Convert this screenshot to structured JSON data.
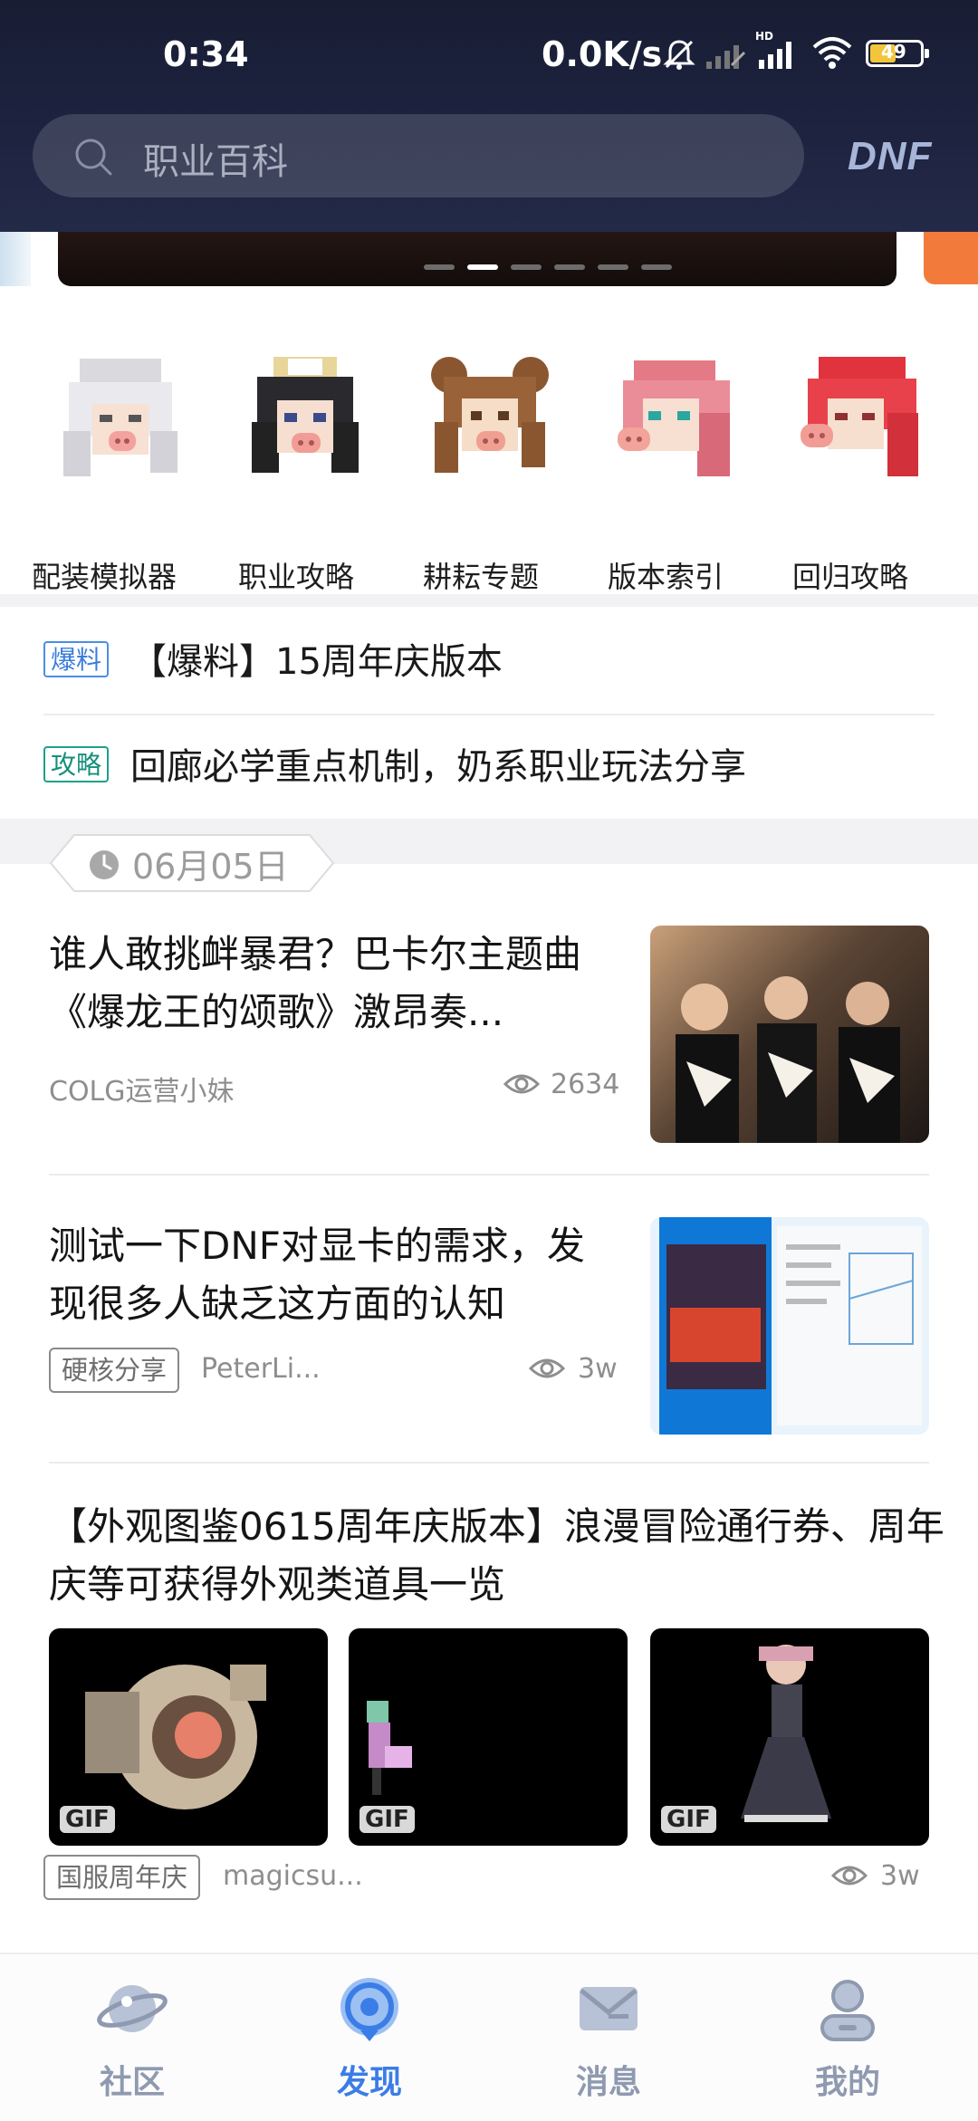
{
  "status_bar": {
    "time": "0:34",
    "network_speed": "0.0K/s",
    "battery": "49"
  },
  "search": {
    "placeholder": "职业百科",
    "brand": "DNF"
  },
  "banner": {
    "page_count": 6,
    "active_index": 1
  },
  "shortcuts": [
    {
      "label": "配装模拟器",
      "icon": "character-white-hair-icon"
    },
    {
      "label": "职业攻略",
      "icon": "character-black-hair-icon"
    },
    {
      "label": "耕耘专题",
      "icon": "character-brown-buns-icon"
    },
    {
      "label": "版本索引",
      "icon": "character-pink-hair-icon"
    },
    {
      "label": "回归攻略",
      "icon": "character-red-hair-icon"
    }
  ],
  "ticker": [
    {
      "tag": "爆料",
      "text": "【爆料】15周年庆版本",
      "tag_color": "#3b7ddb"
    },
    {
      "tag": "攻略",
      "text": "回廊必学重点机制，奶系职业玩法分享",
      "tag_color": "#13907a"
    }
  ],
  "date_label": "06月05日",
  "feed": [
    {
      "title": "谁人敢挑衅暴君？巴卡尔主题曲《爆龙王的颂歌》激昂奏...",
      "author": "COLG运营小妹",
      "views": "2634",
      "thumb": "choir-photo"
    },
    {
      "title": "测试一下DNF对显卡的需求，发现很多人缺乏这方面的认知",
      "tag": "硬核分享",
      "author": "PeterLi...",
      "views": "3w",
      "thumb": "task-manager-screenshot"
    },
    {
      "title": "【外观图鉴0615周年庆版本】浪漫冒险通行券、周年庆等可获得外观类道具一览",
      "tag": "国服周年庆",
      "author": "magicsu...",
      "views": "3w",
      "gif_label": "GIF"
    }
  ],
  "bottom_nav": [
    {
      "label": "社区",
      "icon": "planet-icon",
      "active": false
    },
    {
      "label": "发现",
      "icon": "discover-icon",
      "active": true
    },
    {
      "label": "消息",
      "icon": "mail-icon",
      "active": false
    },
    {
      "label": "我的",
      "icon": "profile-icon",
      "active": false
    }
  ],
  "colors": {
    "accent": "#3b7de6",
    "header_bg": "#1e2440",
    "nav_inactive": "#8f9ab0"
  }
}
